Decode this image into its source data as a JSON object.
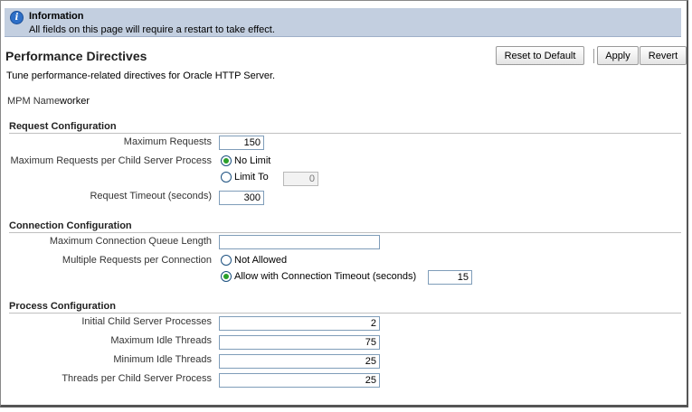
{
  "info": {
    "title": "Information",
    "message": "All fields on this page will require a restart to take effect."
  },
  "page": {
    "title": "Performance Directives",
    "description": "Tune performance-related directives for Oracle HTTP Server.",
    "mpm_label": "MPM Name",
    "mpm_value": "worker"
  },
  "toolbar": {
    "reset_label": "Reset to Default",
    "apply_label": "Apply",
    "revert_label": "Revert"
  },
  "request_config": {
    "title": "Request Configuration",
    "max_requests_label": "Maximum Requests",
    "max_requests_value": "150",
    "max_per_child_label": "Maximum Requests per Child Server Process",
    "no_limit_label": "No Limit",
    "limit_to_label": "Limit To",
    "limit_to_value": "0",
    "timeout_label": "Request Timeout (seconds)",
    "timeout_value": "300"
  },
  "connection_config": {
    "title": "Connection Configuration",
    "queue_length_label": "Maximum Connection Queue Length",
    "queue_length_value": "",
    "multiple_requests_label": "Multiple Requests per Connection",
    "not_allowed_label": "Not Allowed",
    "allow_timeout_label": "Allow with Connection Timeout (seconds)",
    "allow_timeout_value": "15"
  },
  "process_config": {
    "title": "Process Configuration",
    "initial_child_label": "Initial Child Server Processes",
    "initial_child_value": "2",
    "max_idle_label": "Maximum Idle Threads",
    "max_idle_value": "75",
    "min_idle_label": "Minimum Idle Threads",
    "min_idle_value": "25",
    "threads_per_child_label": "Threads per Child Server Process",
    "threads_per_child_value": "25"
  }
}
